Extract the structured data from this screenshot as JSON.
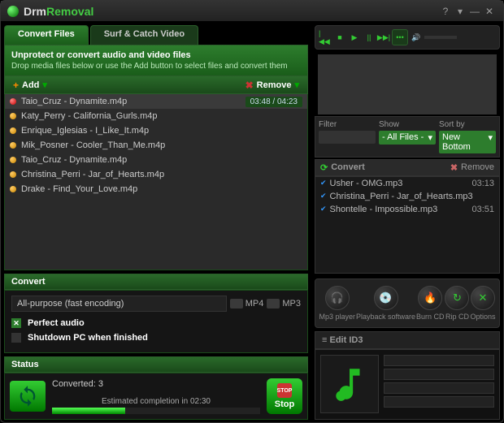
{
  "title": {
    "part1": "Drm",
    "part2": "Removal"
  },
  "tabs": [
    {
      "label": "Convert Files",
      "active": true
    },
    {
      "label": "Surf & Catch Video",
      "active": false
    }
  ],
  "panel": {
    "heading": "Unprotect or convert audio and video files",
    "sub": "Drop media files below or use the Add button to select files and convert them"
  },
  "toolbar": {
    "add": "Add",
    "remove": "Remove"
  },
  "files": [
    {
      "name": "Taio_Cruz - Dynamite.m4p",
      "time": "03:48 / 04:23",
      "active": true
    },
    {
      "name": "Katy_Perry - California_Gurls.m4p"
    },
    {
      "name": "Enrique_Iglesias - I_Like_It.m4p"
    },
    {
      "name": "Mik_Posner - Cooler_Than_Me.m4p"
    },
    {
      "name": "Taio_Cruz - Dynamite.m4p"
    },
    {
      "name": "Christina_Perri - Jar_of_Hearts.m4p"
    },
    {
      "name": "Drake - Find_Your_Love.m4p"
    }
  ],
  "convert": {
    "heading": "Convert",
    "preset": "All-purpose (fast encoding)",
    "fmt_mp4": "MP4",
    "fmt_mp3": "MP3",
    "perfect_audio": "Perfect audio",
    "shutdown": "Shutdown PC when finished"
  },
  "status": {
    "heading": "Status",
    "converted_label": "Converted:",
    "converted_count": "3",
    "eta": "Estimated completion in 02:30",
    "stop": "Stop",
    "stop_small": "STOP"
  },
  "filters": {
    "filter_label": "Filter",
    "show_label": "Show",
    "show_value": "- All Files -",
    "sort_label": "Sort by",
    "sort_value": "New Bottom"
  },
  "rtoolbar": {
    "convert": "Convert",
    "remove": "Remove"
  },
  "queue": [
    {
      "name": "Usher - OMG.mp3",
      "dur": "03:13"
    },
    {
      "name": "Christina_Perri - Jar_of_Hearts.mp3"
    },
    {
      "name": "Shontelle - Impossible.mp3",
      "dur": "03:51"
    }
  ],
  "tools": [
    {
      "label": "Mp3 player",
      "icon": "🎧"
    },
    {
      "label": "Playback software",
      "icon": "💿"
    },
    {
      "label": "Burn CD",
      "icon": "🔥"
    },
    {
      "label": "Rip CD",
      "icon": "↻"
    },
    {
      "label": "Options",
      "icon": "✕"
    }
  ],
  "edit_id3": "Edit ID3"
}
